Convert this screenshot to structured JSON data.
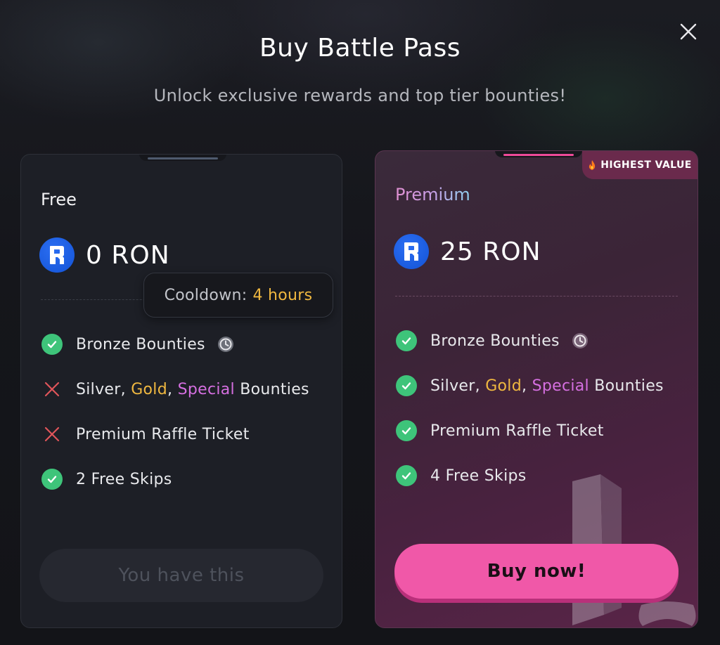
{
  "modal": {
    "title": "Buy Battle Pass",
    "subtitle": "Unlock exclusive rewards and top tier bounties!"
  },
  "icons": {
    "close": "close-icon",
    "ron": "ronin-logo-icon",
    "check": "check-circle-icon",
    "cross": "x-icon",
    "timer": "cooldown-timer-icon",
    "flame": "flame-icon"
  },
  "colors": {
    "accent_pink": "#f058a8",
    "check_green": "#3ec47a",
    "cross_red": "#e0555a",
    "gold": "#f0b840",
    "special": "#d56fe0",
    "ron_blue": "#1b5fe8"
  },
  "free": {
    "name": "Free",
    "price": "0 RON",
    "tooltip": {
      "label": "Cooldown:",
      "value": "4 hours"
    },
    "features": [
      {
        "status": "check",
        "text": "Bronze Bounties",
        "timer": true
      },
      {
        "status": "cross",
        "parts": [
          "Silver, ",
          "Gold",
          ", ",
          "Special",
          " Bounties"
        ]
      },
      {
        "status": "cross",
        "text": "Premium Raffle Ticket"
      },
      {
        "status": "check",
        "text": "2 Free Skips"
      }
    ],
    "button": "You have this"
  },
  "premium": {
    "name": "Premium",
    "badge": "HIGHEST VALUE",
    "price": "25 RON",
    "features": [
      {
        "status": "check",
        "text": "Bronze Bounties",
        "timer": true
      },
      {
        "status": "check",
        "parts": [
          "Silver, ",
          "Gold",
          ", ",
          "Special",
          " Bounties"
        ]
      },
      {
        "status": "check",
        "text": "Premium Raffle Ticket"
      },
      {
        "status": "check",
        "text": "4 Free Skips"
      }
    ],
    "button": "Buy now!"
  }
}
